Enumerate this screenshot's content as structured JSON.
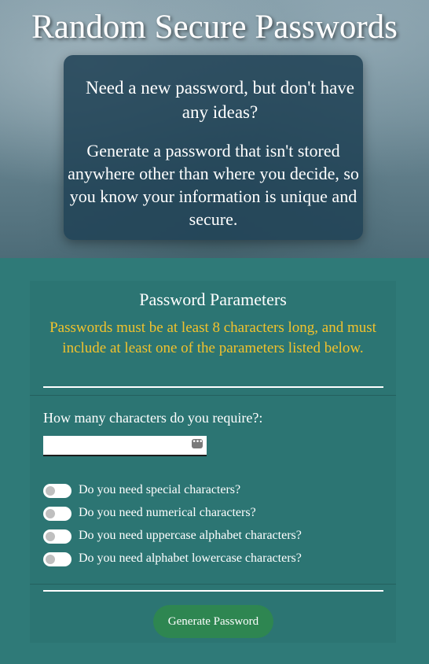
{
  "header": {
    "title": "Random Secure Passwords"
  },
  "intro": {
    "question": "Need a new password, but don't have any ideas?",
    "body": "Generate a password that isn't stored anywhere other than where you decide, so you know your information is unique and secure."
  },
  "params": {
    "title": "Password Parameters",
    "note": "Passwords must be at least 8 characters long, and must include at least one of the parameters listed below.",
    "length_label": "How many characters do you require?:",
    "length_value": "",
    "toggles": [
      {
        "label": "Do you need special characters?",
        "checked": false
      },
      {
        "label": "Do you need numerical characters?",
        "checked": false
      },
      {
        "label": "Do you need uppercase alphabet characters?",
        "checked": false
      },
      {
        "label": "Do you need alphabet lowercase characters?",
        "checked": false
      }
    ],
    "button_label": "Generate Password"
  },
  "colors": {
    "panel_bg": "#2f7a78",
    "note_text": "#f2c22c",
    "button_bg": "#2e8651",
    "intro_card_bg": "#214356"
  },
  "icons": {
    "input_autofill": "key-icon"
  }
}
